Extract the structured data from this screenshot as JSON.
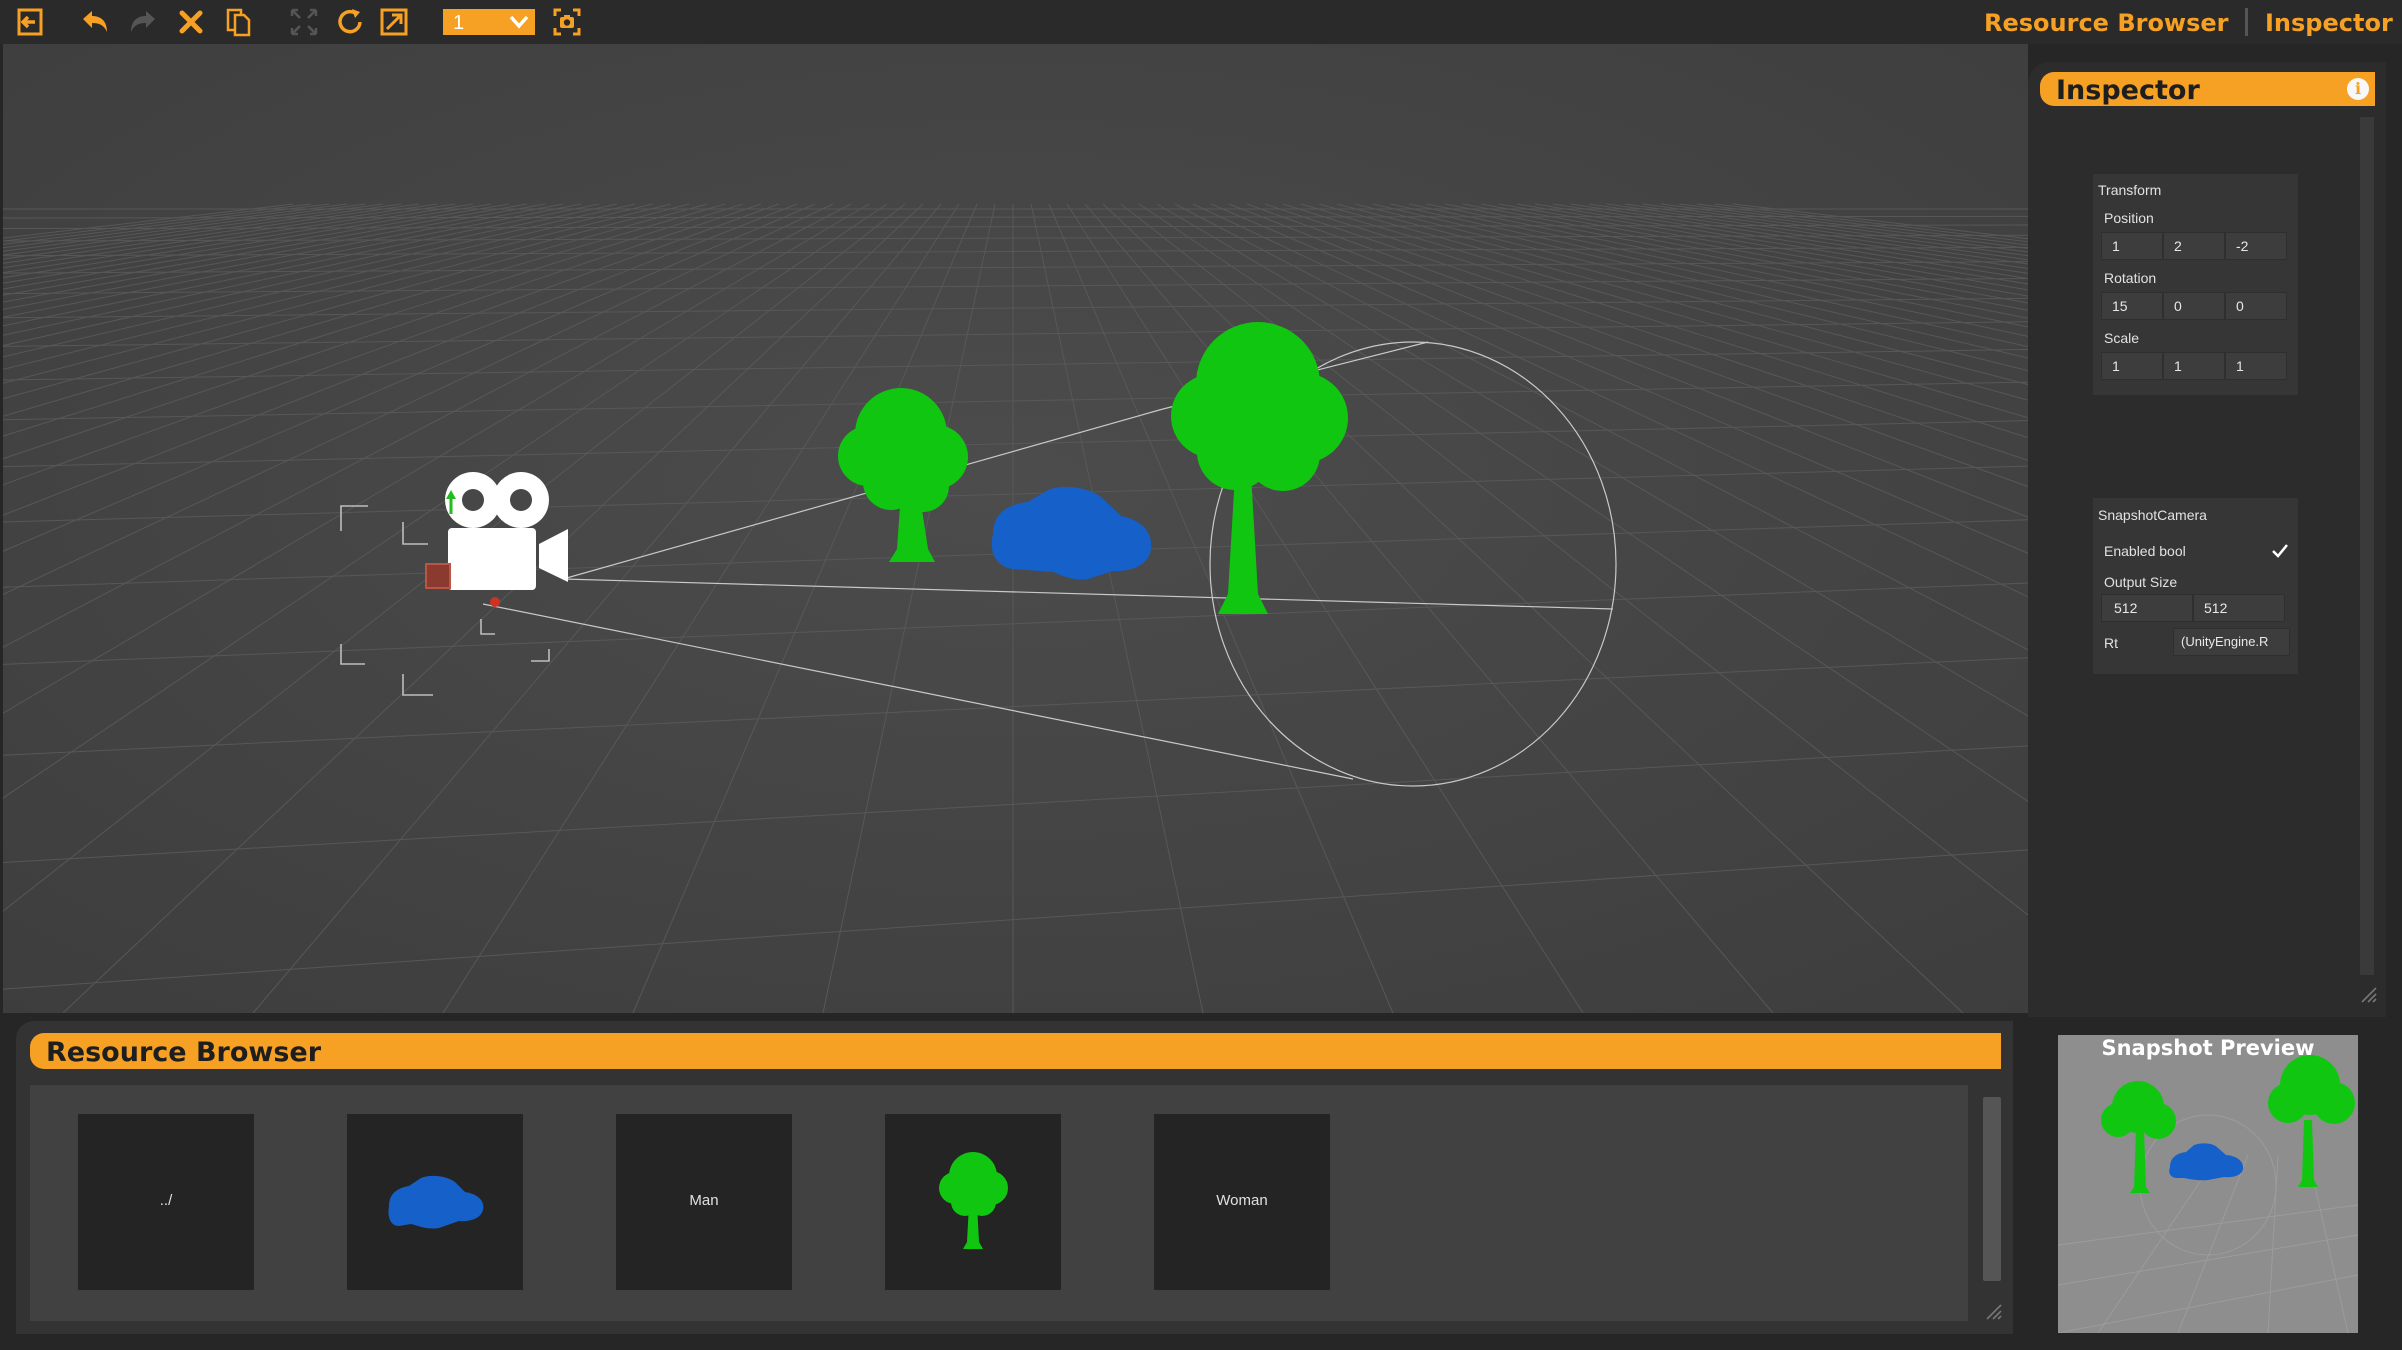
{
  "colors": {
    "accent": "#f6a024",
    "tree_green": "#11c611",
    "car_blue": "#1561c9",
    "viewport_bg": "#474747"
  },
  "toolbar": {
    "icons": [
      "exit-icon",
      "undo-icon",
      "redo-icon",
      "delete-icon",
      "duplicate-icon",
      "move-icon",
      "rotate-icon",
      "scale-icon",
      "screenshot-icon"
    ],
    "layer_value": "1",
    "links": {
      "resource_browser": "Resource Browser",
      "inspector": "Inspector"
    }
  },
  "inspector": {
    "title": "Inspector",
    "transform": {
      "header": "Transform",
      "position_label": "Position",
      "position": [
        "1",
        "2",
        "-2"
      ],
      "rotation_label": "Rotation",
      "rotation": [
        "15",
        "0",
        "0"
      ],
      "scale_label": "Scale",
      "scale": [
        "1",
        "1",
        "1"
      ]
    },
    "snapshot_camera": {
      "header": "SnapshotCamera",
      "enabled_label": "Enabled bool",
      "enabled": true,
      "output_size_label": "Output Size",
      "output_size": [
        "512",
        "512"
      ],
      "rt_label": "Rt",
      "rt_value": "(UnityEngine.R"
    }
  },
  "resource_browser": {
    "title": "Resource Browser",
    "items": [
      {
        "label": "../",
        "kind": "folder-up"
      },
      {
        "label": "",
        "kind": "car-thumbnail"
      },
      {
        "label": "Man",
        "kind": "folder"
      },
      {
        "label": "",
        "kind": "tree-thumbnail"
      },
      {
        "label": "Woman",
        "kind": "folder"
      }
    ]
  },
  "snapshot_preview": {
    "title": "Snapshot Preview"
  }
}
